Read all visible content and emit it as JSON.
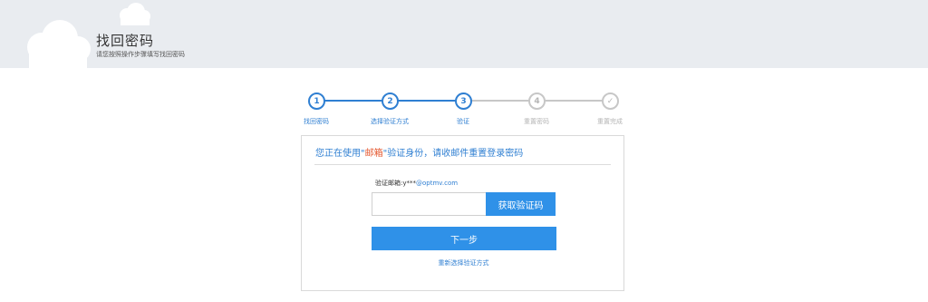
{
  "header": {
    "title": "找回密码",
    "subtitle": "请您按照操作步骤填写找回密码"
  },
  "steps": [
    {
      "number": "1",
      "label": "找回密码",
      "state": "active"
    },
    {
      "number": "2",
      "label": "选择验证方式",
      "state": "active"
    },
    {
      "number": "3",
      "label": "验证",
      "state": "active"
    },
    {
      "number": "4",
      "label": "重置密码",
      "state": "inactive"
    },
    {
      "number": "✓",
      "label": "重置完成",
      "state": "inactive"
    }
  ],
  "notice": {
    "prefix": "您正在使用\"",
    "highlight": "邮箱",
    "suffix": "\"验证身份，请收邮件重置登录密码"
  },
  "email": {
    "label": "验证邮箱:",
    "masked_prefix": "y***",
    "domain": "@optmv.com"
  },
  "code_input": {
    "value": "",
    "placeholder": ""
  },
  "buttons": {
    "get_code": "获取验证码",
    "next": "下一步",
    "reselect": "重新选择验证方式"
  },
  "colors": {
    "accent": "#2f91e8",
    "step_active": "#2f7fd2",
    "step_inactive": "#c7c7c7",
    "highlight": "#e4572e",
    "header_bg": "#e9ecf0"
  },
  "icons": {
    "step5": "check-icon",
    "header_decor": "cloud-icon"
  }
}
